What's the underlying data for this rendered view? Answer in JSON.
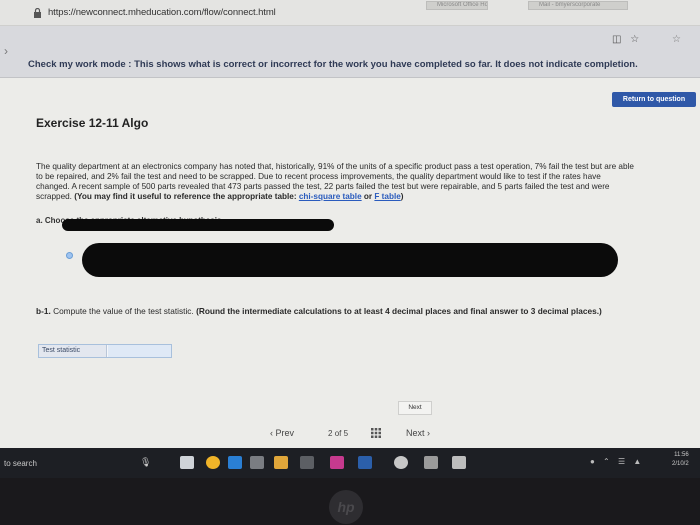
{
  "browser": {
    "url": "https://newconnect.mheducation.com/flow/connect.html",
    "fav_tabs": [
      "Microsoft Office Home",
      "Mail - bmyerscorporate"
    ]
  },
  "banner": {
    "text": "Check my work mode : This shows what is correct or incorrect for the work you have completed so far. It does not indicate completion."
  },
  "main": {
    "return_button": "Return to question",
    "exercise_title": "Exercise 12-11 Algo",
    "problem_text": "The quality department at an electronics company has noted that, historically, 91% of the units of a specific product pass a test operation, 7% fail the test but are able to be repaired, and 2% fail the test and need to be scrapped. Due to recent process improvements, the quality department would like to test if the rates have changed. A recent sample of 500 parts revealed that 473 parts passed the test, 22 parts failed the test but were repairable, and 5 parts failed the test and were scrapped.",
    "reference_note": "(You may find it useful to reference the appropriate table:",
    "link_chi": "chi-square table",
    "or_text": "or",
    "link_f": "F table",
    "close_paren": ")",
    "part_a_label": "a. Choose the appropriate alternative hypothesis.",
    "part_b_label": "b-1.",
    "part_b_text": "Compute the value of the test statistic.",
    "part_b_instructions": "(Round the intermediate calculations to at least 4 decimal places and final answer to 3 decimal places.)",
    "test_statistic_label": "Test statistic",
    "test_statistic_value": "",
    "next_small": "Next"
  },
  "pager": {
    "prev": "Prev",
    "current": "2",
    "of": "of",
    "total": "5",
    "next": "Next"
  },
  "taskbar": {
    "search": "to search",
    "clock_time": "11:56",
    "clock_date": "2/10/2"
  },
  "colors": {
    "link": "#2a5bbd",
    "return_button": "#2f58a8",
    "banner_text": "#2f3a55"
  }
}
